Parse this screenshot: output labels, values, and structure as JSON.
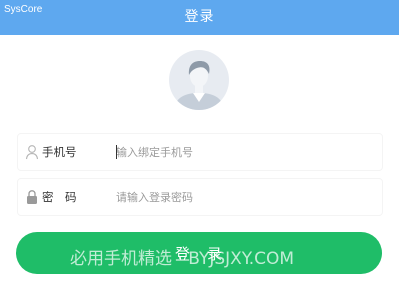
{
  "app": {
    "name": "SysCore",
    "title": "登录"
  },
  "phone": {
    "label": "手机号",
    "placeholder": "输入绑定手机号",
    "value": ""
  },
  "password": {
    "label": "密　码",
    "placeholder": "请输入登录密码",
    "value": ""
  },
  "login_button": {
    "label": "登　录"
  },
  "watermark": "必用手机精选 · BYJSJXY.COM",
  "colors": {
    "header": "#5ea8ef",
    "button": "#1fbd68"
  },
  "icons": {
    "avatar": "user-avatar",
    "phone": "user-icon",
    "password": "lock-icon"
  }
}
